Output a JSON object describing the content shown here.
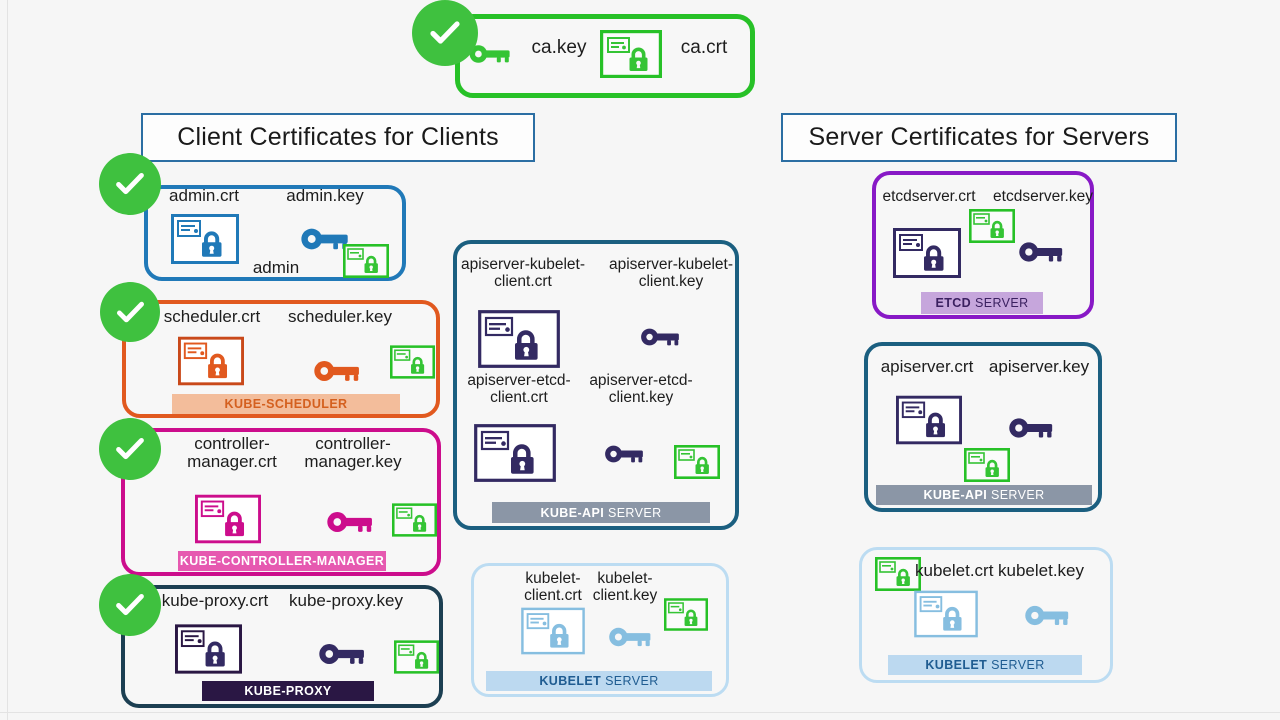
{
  "page": {
    "title": "Kubernetes TLS Certificates Overview",
    "background_color": "#f6f6f6"
  },
  "ca": {
    "key_label": "ca.key",
    "crt_label": "ca.crt",
    "accent_color": "#27c127",
    "check_icon": "check-circle-icon",
    "key_icon": "key-icon",
    "cert_icon": "certificate-lock-icon"
  },
  "headers": {
    "client": "Client Certificates for Clients",
    "server": "Server Certificates for Servers",
    "border_color": "#2b6ea3"
  },
  "client_cards": [
    {
      "id": "admin",
      "crt_label": "admin.crt",
      "key_label": "admin.key",
      "extra_label": "admin",
      "banner_bold": "",
      "banner_thin": "",
      "accent_color": "#2079b8",
      "banner_bg": "",
      "banner_text_color": "",
      "has_banner": false,
      "checked": true
    },
    {
      "id": "kube-scheduler",
      "crt_label": "scheduler.crt",
      "key_label": "scheduler.key",
      "extra_label": "",
      "banner_bold": "KUBE-SCHEDULER",
      "banner_thin": "",
      "accent_color": "#e1591f",
      "banner_bg": "#f3bd9b",
      "banner_text_color": "#d4601f",
      "has_banner": true,
      "checked": true
    },
    {
      "id": "kube-controller-manager",
      "crt_label": "controller-\nmanager.crt",
      "key_label": "controller-\nmanager.key",
      "extra_label": "",
      "banner_bold": "KUBE-CONTROLLER-MANAGER",
      "banner_thin": "",
      "accent_color": "#cc0d8c",
      "banner_bg": "#e659b0",
      "banner_text_color": "#ffffff",
      "has_banner": true,
      "checked": true
    },
    {
      "id": "kube-proxy",
      "crt_label": "kube-proxy.crt",
      "key_label": "kube-proxy.key",
      "extra_label": "",
      "banner_bold": "KUBE-PROXY",
      "banner_thin": "",
      "accent_color": "#1c3f52",
      "banner_bg": "#2a1744",
      "banner_text_color": "#ffffff",
      "has_banner": true,
      "checked": true
    }
  ],
  "middle_cards": [
    {
      "id": "kube-api-server-client",
      "labels": [
        "apiserver-kubelet-\nclient.crt",
        "apiserver-kubelet-\nclient.key",
        "apiserver-etcd-\nclient.crt",
        "apiserver-etcd-\nclient.key"
      ],
      "banner_bold": "KUBE-API",
      "banner_thin": "SERVER",
      "accent_color": "#1b5f80",
      "banner_bg": "#8b96a6",
      "banner_text_color": "#ffffff",
      "icon_color": "#332a62"
    },
    {
      "id": "kubelet-server-client",
      "labels": [
        "kubelet-\nclient.crt",
        "kubelet-\nclient.key"
      ],
      "banner_bold": "KUBELET",
      "banner_thin": "SERVER",
      "accent_color": "#bcdcf2",
      "banner_bg": "#bcd9f0",
      "banner_text_color": "#1f5c91",
      "icon_color": "#86bee0"
    }
  ],
  "server_cards": [
    {
      "id": "etcd-server",
      "crt_label": "etcdserver.crt",
      "key_label": "etcdserver.key",
      "banner_bold": "ETCD",
      "banner_thin": "SERVER",
      "accent_color": "#8819c6",
      "banner_bg": "#c6a6dc",
      "banner_text_color": "#3b2060",
      "icon_color": "#332a62"
    },
    {
      "id": "kube-api-server",
      "crt_label": "apiserver.crt",
      "key_label": "apiserver.key",
      "banner_bold": "KUBE-API",
      "banner_thin": "SERVER",
      "accent_color": "#1b5f80",
      "banner_bg": "#8b96a6",
      "banner_text_color": "#ffffff",
      "icon_color": "#332a62"
    },
    {
      "id": "kubelet-server",
      "crt_label": "kubelet.crt",
      "key_label": "kubelet.key",
      "banner_bold": "KUBELET",
      "banner_thin": "SERVER",
      "accent_color": "#bcdcf2",
      "banner_bg": "#bcd9f0",
      "banner_text_color": "#1f5c91",
      "icon_color": "#86bee0"
    }
  ],
  "icons": {
    "cert": "certificate-lock-icon",
    "key": "key-icon",
    "ca_cert": "ca-certificate-lock-icon",
    "check": "check-circle-icon"
  }
}
